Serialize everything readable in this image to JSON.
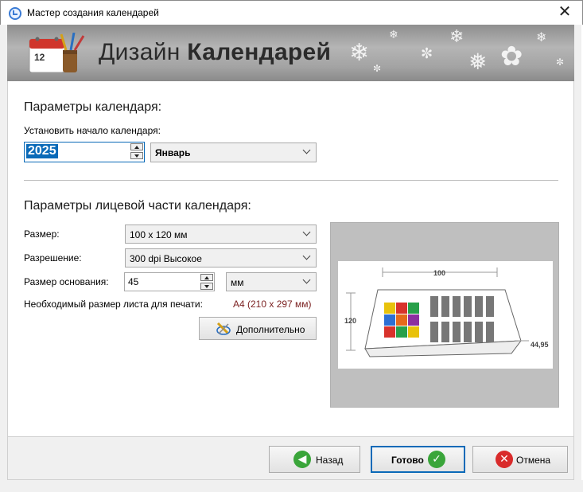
{
  "window": {
    "title": "Мастер создания календарей",
    "close_glyph": "✕"
  },
  "banner": {
    "title_light": "Дизайн ",
    "title_bold": "Календарей",
    "logo_day": "12"
  },
  "calendar_params": {
    "heading": "Параметры календаря:",
    "start_label": "Установить начало календаря:",
    "year_value": "2025",
    "month_value": "Январь"
  },
  "front_params": {
    "heading": "Параметры лицевой части календаря:",
    "size_label": "Размер:",
    "size_value": "100 x 120 мм",
    "resolution_label": "Разрешение:",
    "resolution_value": "300 dpi Высокое",
    "base_label": "Размер основания:",
    "base_value": "45",
    "base_unit": "мм",
    "sheet_label": "Необходимый размер листа для печати:",
    "sheet_value": "A4 (210 x 297 мм)",
    "advanced_label": "Дополнительно"
  },
  "preview": {
    "dim_width": "100",
    "dim_height": "120",
    "dim_depth": "44,95"
  },
  "footer": {
    "back_label": "Назад",
    "done_label": "Готово",
    "cancel_label": "Отмена"
  },
  "colors": {
    "accent_border": "#0a6ab8",
    "sheet_value_color": "#7a1f1f",
    "back_icon": "#3aa53a",
    "done_icon": "#3aa53a",
    "cancel_icon": "#d92b2b"
  }
}
